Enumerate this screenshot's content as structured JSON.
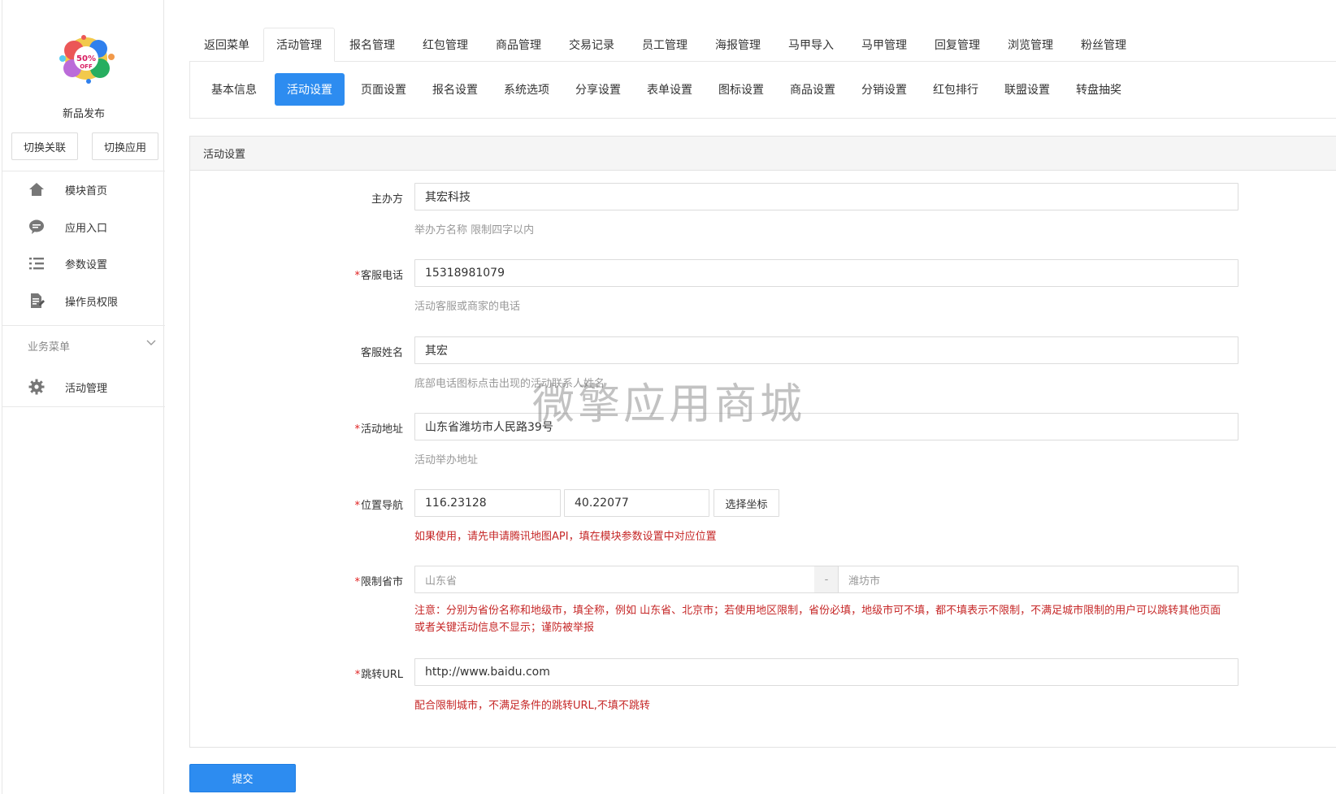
{
  "app": {
    "name": "新品发布",
    "logo_text": "50% OFF"
  },
  "sidebar": {
    "switch_buttons": [
      "切换关联",
      "切换应用"
    ],
    "items": [
      {
        "label": "模块首页",
        "icon": "home-icon"
      },
      {
        "label": "应用入口",
        "icon": "chat-icon"
      },
      {
        "label": "参数设置",
        "icon": "list-icon"
      },
      {
        "label": "操作员权限",
        "icon": "doc-edit-icon"
      }
    ],
    "section_title": "业务菜单",
    "section_items": [
      {
        "label": "活动管理",
        "icon": "gear-icon"
      }
    ]
  },
  "tabs": {
    "items": [
      "返回菜单",
      "活动管理",
      "报名管理",
      "红包管理",
      "商品管理",
      "交易记录",
      "员工管理",
      "海报管理",
      "马甲导入",
      "马甲管理",
      "回复管理",
      "浏览管理",
      "粉丝管理"
    ],
    "active_index": 1
  },
  "subnav": {
    "items": [
      "基本信息",
      "活动设置",
      "页面设置",
      "报名设置",
      "系统选项",
      "分享设置",
      "表单设置",
      "图标设置",
      "商品设置",
      "分销设置",
      "红包排行",
      "联盟设置",
      "转盘抽奖"
    ],
    "active_index": 1
  },
  "panel": {
    "title": "活动设置"
  },
  "form": {
    "organizer": {
      "label": "主办方",
      "required": false,
      "value": "其宏科技",
      "help": "举办方名称 限制四字以内"
    },
    "phone": {
      "label": "客服电话",
      "required": true,
      "value": "15318981079",
      "help": "活动客服或商家的电话"
    },
    "service_name": {
      "label": "客服姓名",
      "required": false,
      "value": "其宏",
      "help": "底部电话图标点击出现的活动联系人姓名"
    },
    "address": {
      "label": "活动地址",
      "required": true,
      "value": "山东省潍坊市人民路39号",
      "help": "活动举办地址"
    },
    "location": {
      "label": "位置导航",
      "required": true,
      "lng": "116.23128",
      "lat": "40.22077",
      "button": "选择坐标",
      "help": "如果使用，请先申请腾讯地图API，填在模块参数设置中对应位置"
    },
    "region": {
      "label": "限制省市",
      "required": true,
      "province_placeholder": "山东省",
      "separator": "-",
      "city_placeholder": "潍坊市",
      "help": "注意：分别为省份名称和地级市，填全称，例如 山东省、北京市；若使用地区限制，省份必填，地级市可不填，都不填表示不限制，不满足城市限制的用户可以跳转其他页面或者关键活动信息不显示；谨防被举报"
    },
    "redirect": {
      "label": "跳转URL",
      "required": true,
      "value": "http://www.baidu.com",
      "help": "配合限制城市，不满足条件的跳转URL,不填不跳转"
    }
  },
  "submit_label": "提交",
  "watermark": "微擎应用商城",
  "colors": {
    "primary": "#2d8cf0",
    "danger": "#c62828",
    "muted": "#999999"
  }
}
